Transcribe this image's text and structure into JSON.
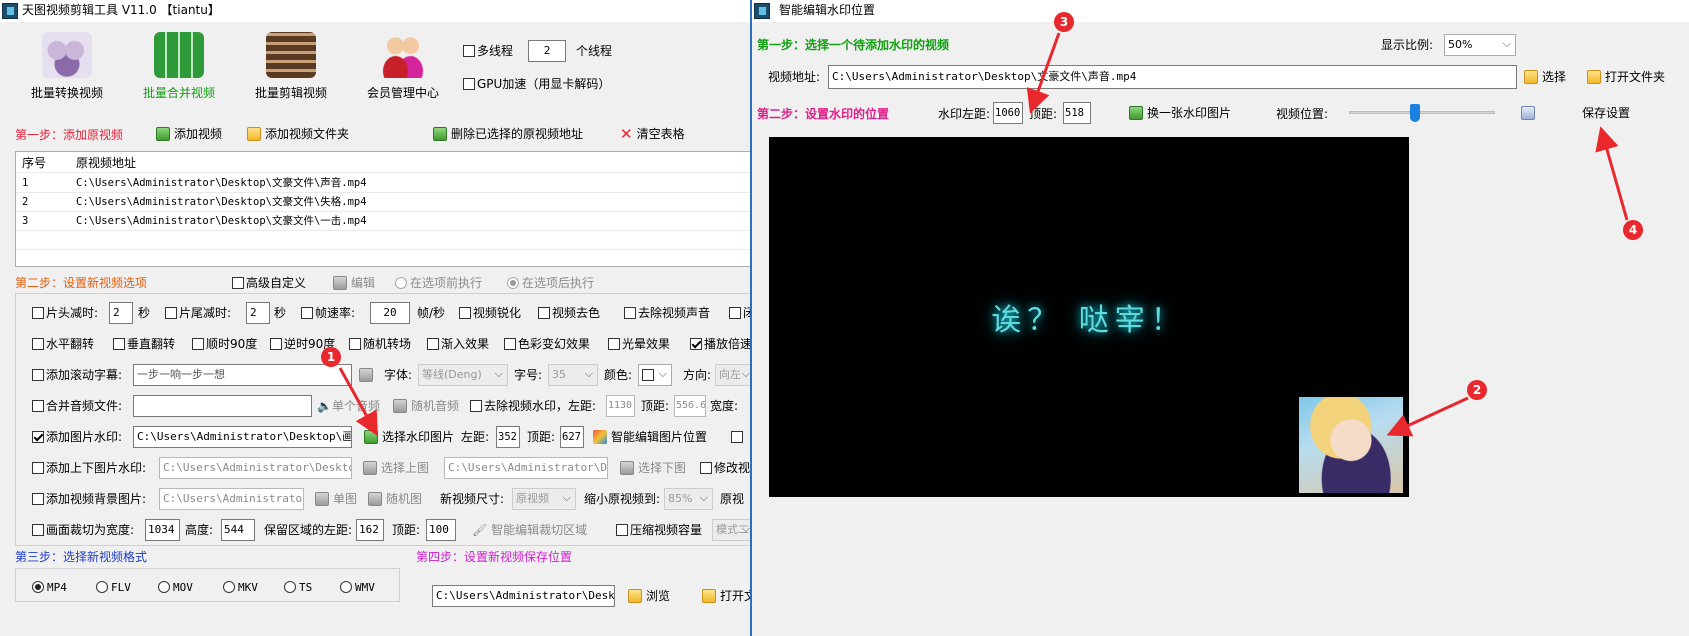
{
  "left_window": {
    "title": "天图视频剪辑工具 V11.0 【tiantu】",
    "top_buttons": [
      "批量转换视频",
      "批量合并视频",
      "批量剪辑视频",
      "会员管理中心"
    ],
    "multithread_label": "多线程",
    "thread_count": "2",
    "thread_unit": "个线程",
    "gpu_label": "GPU加速（用显卡解码）",
    "step1": {
      "title": "第一步：添加原视频",
      "add_video": "添加视频",
      "add_folder": "添加视频文件夹",
      "delete_selected": "删除已选择的原视频地址",
      "clear_table": "清空表格"
    },
    "table": {
      "headers": [
        "序号",
        "原视频地址"
      ],
      "rows": [
        {
          "no": "1",
          "path": "C:\\Users\\Administrator\\Desktop\\文豪文件\\声音.mp4"
        },
        {
          "no": "2",
          "path": "C:\\Users\\Administrator\\Desktop\\文豪文件\\失格.mp4"
        },
        {
          "no": "3",
          "path": "C:\\Users\\Administrator\\Desktop\\文豪文件\\一击.mp4"
        }
      ]
    },
    "step2": {
      "title": "第二步：设置新视频选项",
      "advanced": "高级自定义",
      "edit": "编辑",
      "before": "在选项前执行",
      "after": "在选项后执行"
    },
    "row1": {
      "head_cut": "片头减时:",
      "head_val": "2",
      "sec1": "秒",
      "tail_cut": "片尾减时:",
      "tail_val": "2",
      "sec2": "秒",
      "fps": "帧速率:",
      "fps_val": "20",
      "fps_unit": "帧/秒",
      "sharpen": "视频锐化",
      "decolor": "视频去色",
      "remove_audio": "去除视频声音",
      "more": "闭"
    },
    "row2": {
      "hflip": "水平翻转",
      "vflip": "垂直翻转",
      "cw90": "顺时90度",
      "ccw90": "逆时90度",
      "random_trans": "随机转场",
      "fade_in": "渐入效果",
      "color_fx": "色彩变幻效果",
      "halo": "光晕效果",
      "speed": "播放倍速"
    },
    "row3": {
      "scroll_sub": "添加滚动字幕:",
      "sub_text": "一步一响一步一想",
      "font_label": "字体:",
      "font_val": "等线(Deng)",
      "size_label": "字号:",
      "size_val": "35",
      "color_label": "颜色:",
      "dir_label": "方向:",
      "dir_val": "向左"
    },
    "row4": {
      "merge_audio": "合并音频文件:",
      "single_audio": "单个音频",
      "random_audio": "随机音频",
      "remove_wm": "去除视频水印，左距:",
      "left_val": "1130",
      "top_label": "顶距:",
      "top_val": "556.6",
      "width_label": "宽度:"
    },
    "row5": {
      "add_img_wm": "添加图片水印:",
      "img_path": "C:\\Users\\Administrator\\Desktop\\画中画",
      "select_wm": "选择水印图片",
      "left_label": "左距:",
      "left_val": "352",
      "top_label": "顶距:",
      "top_val": "627",
      "smart_edit": "智能编辑图片位置"
    },
    "row6": {
      "add_tb_wm": "添加上下图片水印:",
      "top_path": "C:\\Users\\Administrator\\Desktop\\Q",
      "select_top": "选择上图",
      "bottom_path": "C:\\Users\\Administrator\\Desk",
      "select_bottom": "选择下图",
      "modify": "修改视"
    },
    "row7": {
      "add_bg": "添加视频背景图片:",
      "bg_path": "C:\\Users\\Administrator\\D",
      "single_img": "单图",
      "random_img": "随机图",
      "new_size": "新视频尺寸:",
      "size_val": "原视频",
      "shrink": "缩小原视频到:",
      "shrink_val": "85%",
      "orig": "原视"
    },
    "row8": {
      "crop": "画面裁切为宽度:",
      "crop_w": "1034",
      "height_label": "高度:",
      "crop_h": "544",
      "keep_left": "保留区域的左距:",
      "keep_left_val": "162",
      "top_label": "顶距:",
      "keep_top_val": "100",
      "smart_crop": "智能编辑裁切区域",
      "compress": "压缩视频容量",
      "mode": "模式二"
    },
    "step3": {
      "title": "第三步：选择新视频格式",
      "formats": [
        "MP4",
        "FLV",
        "MOV",
        "MKV",
        "TS",
        "WMV"
      ],
      "selected": "MP4"
    },
    "step4": {
      "title": "第四步：设置新视频保存位置",
      "save_path": "C:\\Users\\Administrator\\Desktop",
      "browse": "浏览",
      "open_folder": "打开文"
    }
  },
  "right_window": {
    "title": "智能编辑水印位置",
    "step1_title": "第一步：选择一个待添加水印的视频",
    "ratio_label": "显示比例:",
    "ratio_val": "50%",
    "path_label": "视频地址:",
    "path_val": "C:\\Users\\Administrator\\Desktop\\文豪文件\\声音.mp4",
    "select": "选择",
    "open_folder": "打开文件夹",
    "step2_title": "第二步：设置水印的位置",
    "wm_left_label": "水印左距:",
    "wm_left_val": "1060",
    "wm_top_label": "顶距:",
    "wm_top_val": "518",
    "change_wm": "换一张水印图片",
    "video_pos": "视频位置:",
    "video_pos_fraction": 0.45,
    "save": "保存设置",
    "preview_text": "诶？ 哒宰！"
  },
  "markers": [
    "1",
    "2",
    "3",
    "4"
  ],
  "colors": {
    "step_red": "#e8203a",
    "step_green": "#10a010",
    "step_blue": "#1d3ec9",
    "step_magenta": "#d020d0",
    "arrow_red": "#e8282d",
    "preview_bg": "#000000",
    "glow_text": "#52d8e0"
  }
}
